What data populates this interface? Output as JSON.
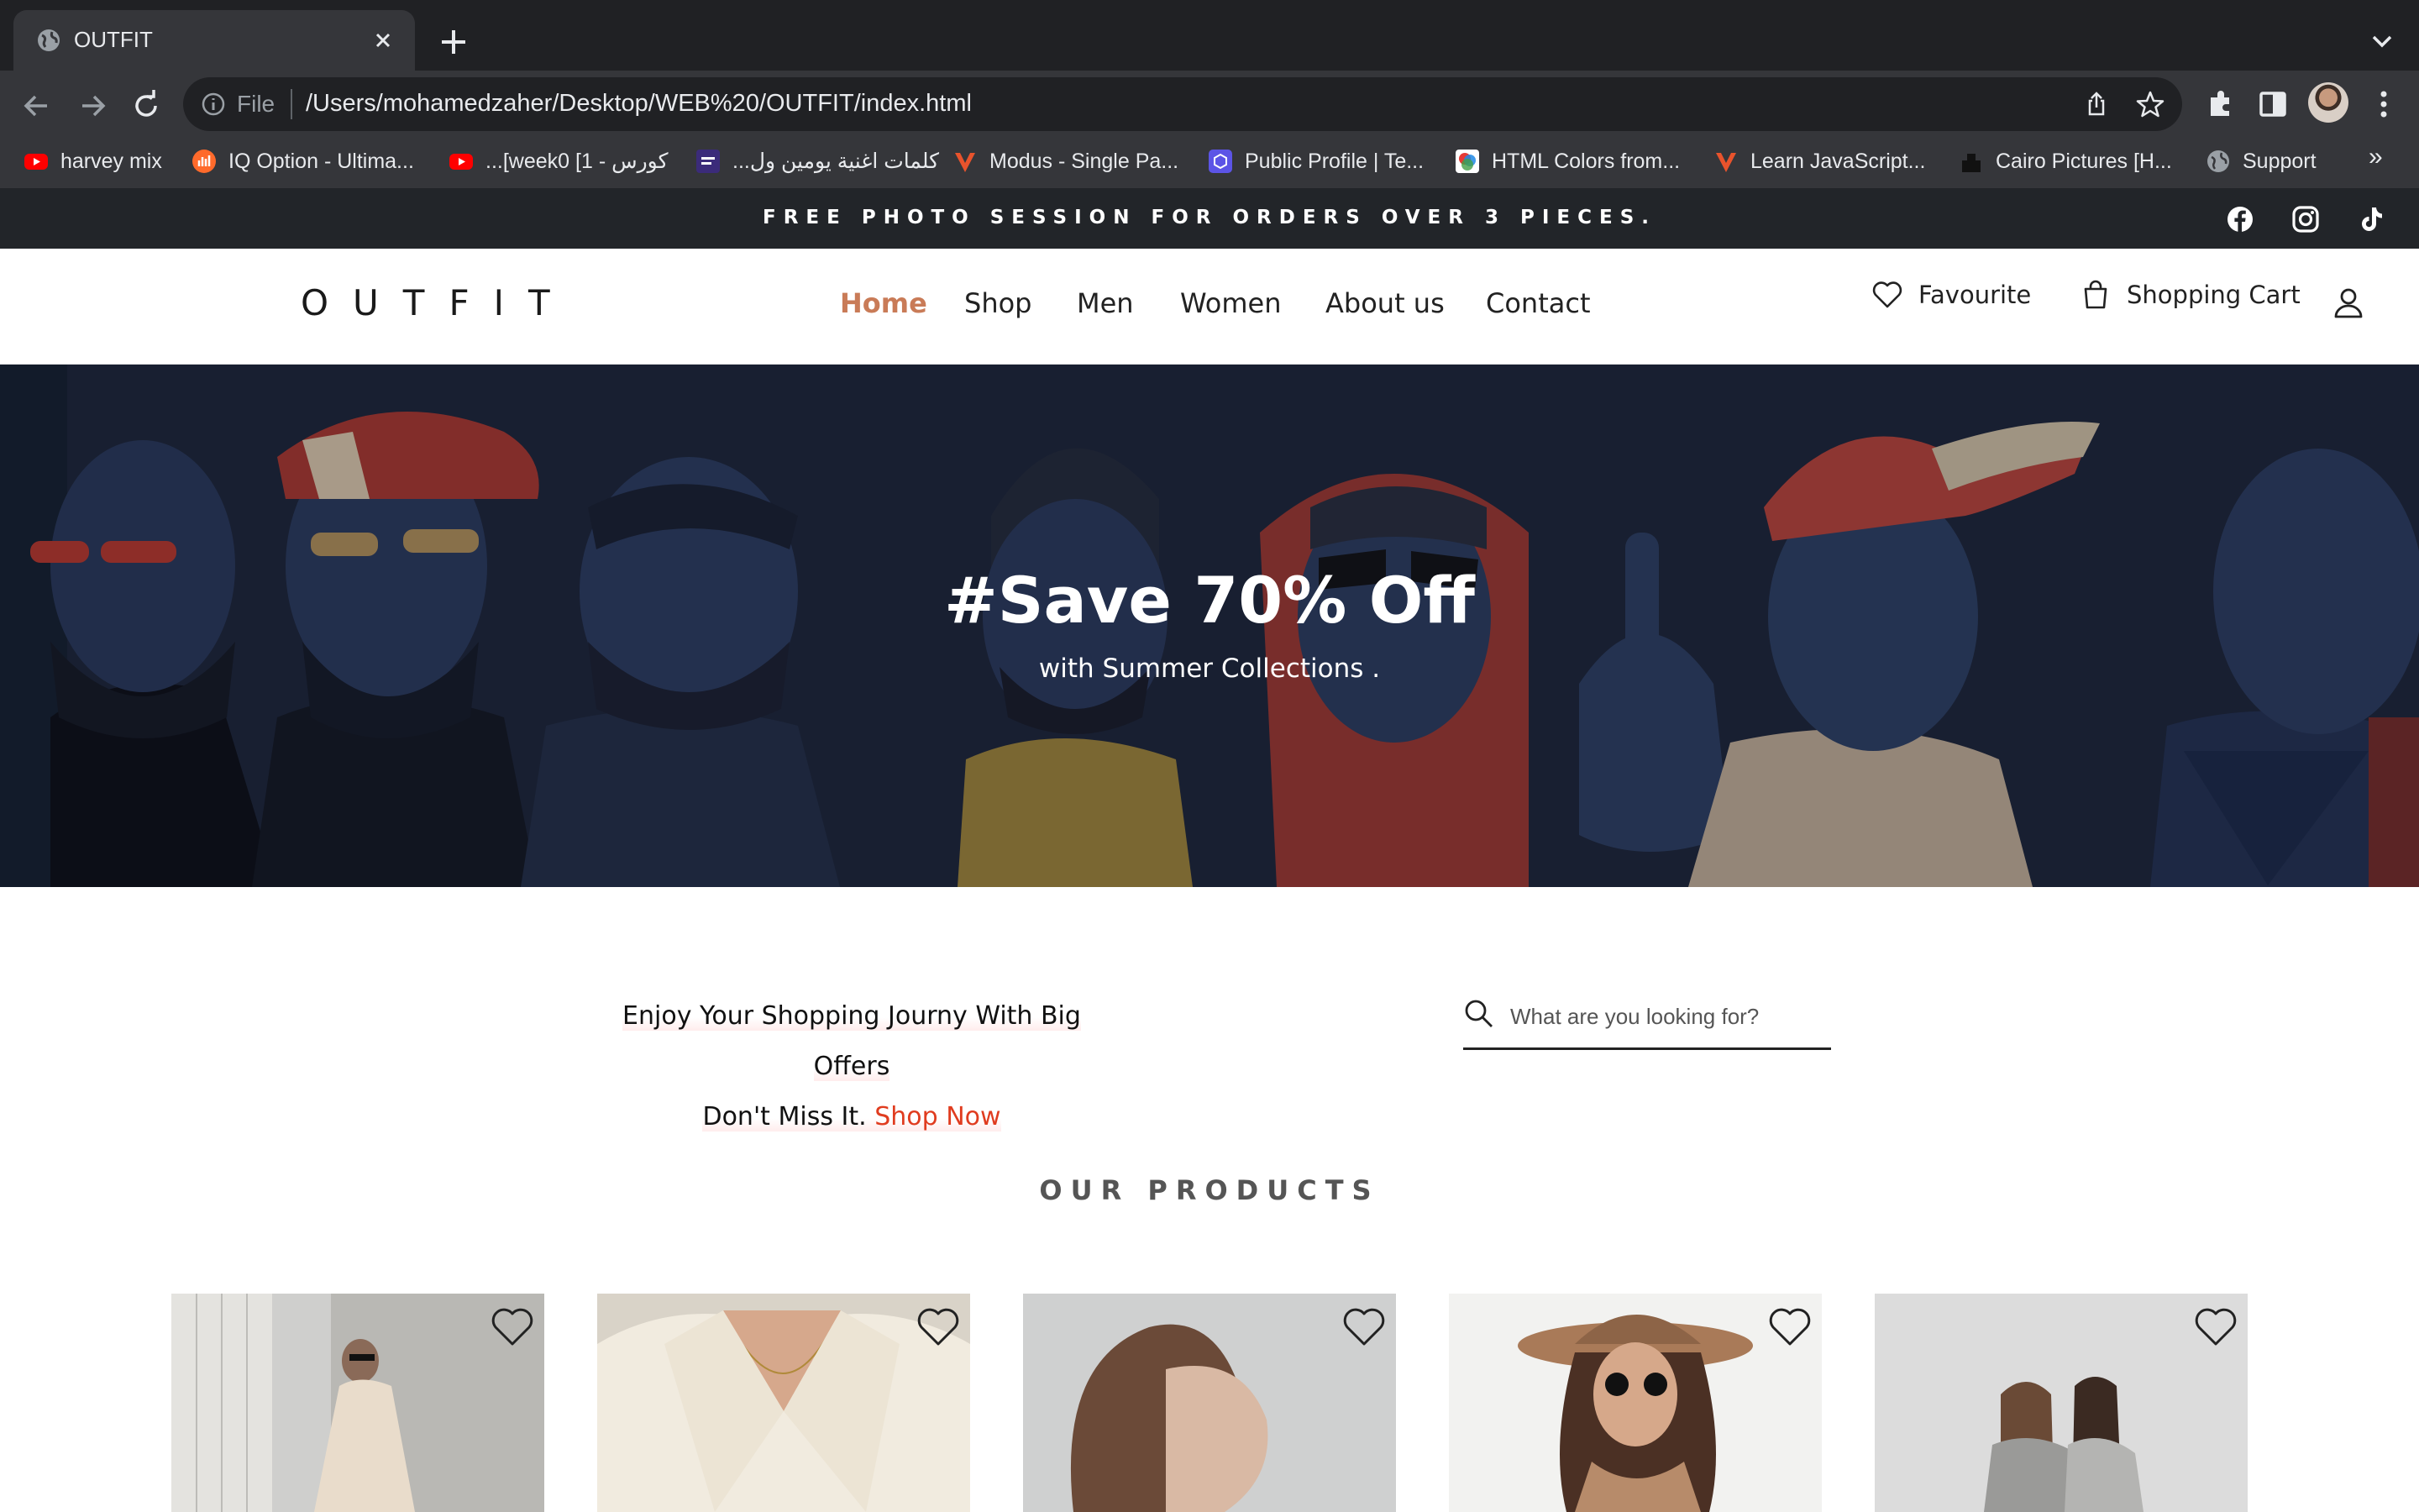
{
  "browser": {
    "tab_title": "OUTFIT",
    "address_prefix": "File",
    "url": "/Users/mohamedzaher/Desktop/WEB%20/OUTFIT/index.html",
    "bookmarks": [
      {
        "label": "harvey mix",
        "icon": "youtube-icon",
        "color": "#ff0000"
      },
      {
        "label": "IQ Option - Ultima...",
        "icon": "iq-option-icon",
        "color": "#ff6a2b"
      },
      {
        "label": "كورس - 1] week0]...",
        "icon": "youtube-icon",
        "color": "#ff0000"
      },
      {
        "label": "كلمات اغنية يومين ول...",
        "icon": "lyrics-site-icon",
        "color": "#3b2b7a"
      },
      {
        "label": "Modus - Single Pa...",
        "icon": "modus-icon",
        "color": "#e8532c"
      },
      {
        "label": "Public Profile | Te...",
        "icon": "profile-site-icon",
        "color": "#5c54e6"
      },
      {
        "label": "HTML Colors from...",
        "icon": "html-colors-icon",
        "color": "#ffffff"
      },
      {
        "label": "Learn JavaScript...",
        "icon": "learn-js-icon",
        "color": "#e8532c"
      },
      {
        "label": "Cairo Pictures [H...",
        "icon": "cairo-pictures-icon",
        "color": "#111111"
      },
      {
        "label": "Support",
        "icon": "globe-icon",
        "color": "#9aa0a6"
      }
    ],
    "bookmarks_more": "»"
  },
  "announcement": {
    "text": "FREE PHOTO SESSION FOR ORDERS OVER 3 PIECES."
  },
  "header": {
    "logo": "OUTFIT",
    "nav": [
      {
        "label": "Home",
        "active": true
      },
      {
        "label": "Shop"
      },
      {
        "label": "Men"
      },
      {
        "label": "Women"
      },
      {
        "label": "About us"
      },
      {
        "label": "Contact"
      }
    ],
    "favourite_label": "Favourite",
    "cart_label": "Shopping Cart"
  },
  "hero": {
    "title": "#Save 70% Off",
    "subtitle": "with Summer Collections ."
  },
  "promo": {
    "line1": "Enjoy Your Shopping Journy With Big Offers",
    "line2": "Don't Miss It.",
    "link": "Shop Now"
  },
  "search": {
    "placeholder": "What are you looking for?"
  },
  "products": {
    "title": "OUR PRODUCTS",
    "items": [
      {
        "image": "woman-beige-sweatsuit-street"
      },
      {
        "image": "woman-white-satin-shirt"
      },
      {
        "image": "woman-profile-portrait"
      },
      {
        "image": "woman-hat-sunglasses"
      },
      {
        "image": "two-women-grey-coats"
      }
    ]
  },
  "colors": {
    "accent": "#c97b57",
    "shop_now": "#e03c1f",
    "announcement_bg": "#222529",
    "chrome_bg": "#35363a"
  }
}
